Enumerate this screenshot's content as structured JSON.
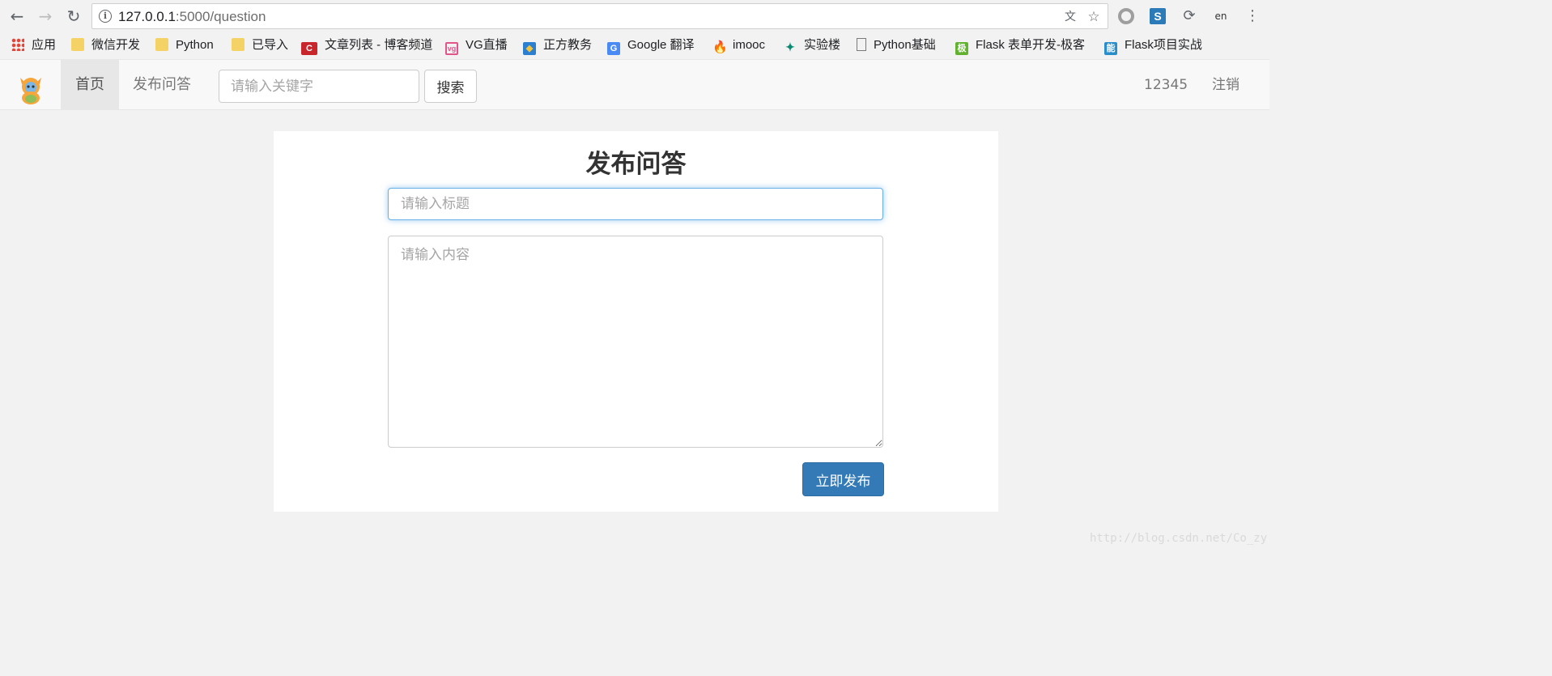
{
  "browser": {
    "url_host": "127.0.0.1",
    "url_path": ":5000/question",
    "bookmarks": [
      {
        "label": "应用",
        "icon": "apps-icon"
      },
      {
        "label": "微信开发",
        "icon": "folder-icon"
      },
      {
        "label": "Python",
        "icon": "folder-icon"
      },
      {
        "label": "已导入",
        "icon": "folder-icon"
      },
      {
        "label": "文章列表 - 博客频道",
        "icon": "csdn-icon"
      },
      {
        "label": "VG直播",
        "icon": "vg-icon"
      },
      {
        "label": "正方教务",
        "icon": "zf-icon"
      },
      {
        "label": "Google 翻译",
        "icon": "google-translate-icon"
      },
      {
        "label": "imooc",
        "icon": "imooc-icon"
      },
      {
        "label": "实验楼",
        "icon": "shiyanlou-icon"
      },
      {
        "label": "Python基础",
        "icon": "page-icon"
      },
      {
        "label": "Flask 表单开发-极客",
        "icon": "jike-icon"
      },
      {
        "label": "Flask项目实战",
        "icon": "neng-icon"
      }
    ]
  },
  "navbar": {
    "home_label": "首页",
    "publish_label": "发布问答",
    "search_placeholder": "请输入关键字",
    "search_button": "搜索",
    "username": "12345",
    "logout_label": "注销"
  },
  "main": {
    "title": "发布问答",
    "title_placeholder": "请输入标题",
    "content_placeholder": "请输入内容",
    "submit_label": "立即发布"
  },
  "watermark": "http://blog.csdn.net/Co_zy",
  "colors": {
    "primary_button": "#337ab7",
    "focus_border": "#66afe9",
    "navbar_bg": "#f8f8f8",
    "page_bg": "#f2f2f2"
  }
}
